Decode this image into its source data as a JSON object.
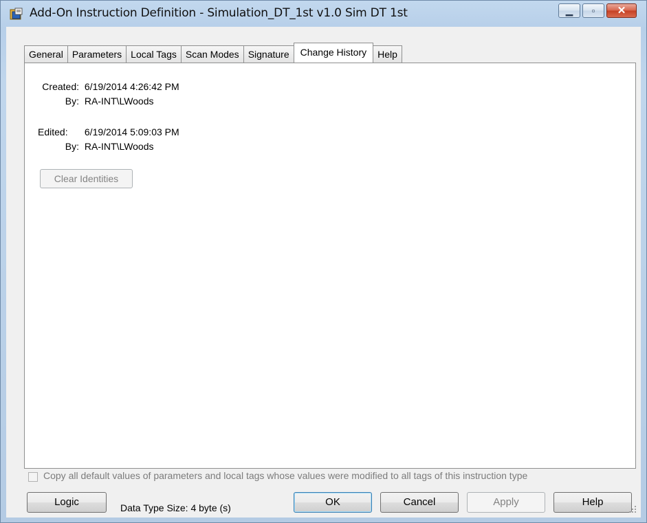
{
  "window": {
    "title": "Add-On Instruction Definition - Simulation_DT_1st v1.0 Sim DT 1st",
    "controls": {
      "minimize_icon": "minimize-icon",
      "maximize_icon": "maximize-icon",
      "close_icon": "close-icon"
    }
  },
  "tabs": [
    {
      "label": "General",
      "active": false
    },
    {
      "label": "Parameters",
      "active": false
    },
    {
      "label": "Local Tags",
      "active": false
    },
    {
      "label": "Scan Modes",
      "active": false
    },
    {
      "label": "Signature",
      "active": false
    },
    {
      "label": "Change History",
      "active": true
    },
    {
      "label": "Help",
      "active": false
    }
  ],
  "change_history": {
    "created_label": "Created:",
    "created_value": "6/19/2014  4:26:42 PM",
    "created_by_label": "By:",
    "created_by_value": "RA-INT\\LWoods",
    "edited_label": "Edited:",
    "edited_value": "6/19/2014  5:09:03 PM",
    "edited_by_label": "By:",
    "edited_by_value": "RA-INT\\LWoods",
    "clear_button": "Clear Identities"
  },
  "footer": {
    "copy_defaults_label": "Copy all default values of parameters and local tags whose values were modified to all tags of this instruction type",
    "copy_defaults_checked": false,
    "logic_button": "Logic",
    "data_type_size": "Data Type Size: 4 byte (s)",
    "ok_button": "OK",
    "cancel_button": "Cancel",
    "apply_button": "Apply",
    "help_button": "Help"
  },
  "colors": {
    "title_bar": "#c2d8ee",
    "close_button": "#c53f23",
    "panel_bg": "#ffffff",
    "dialog_bg": "#f0f0f0"
  }
}
